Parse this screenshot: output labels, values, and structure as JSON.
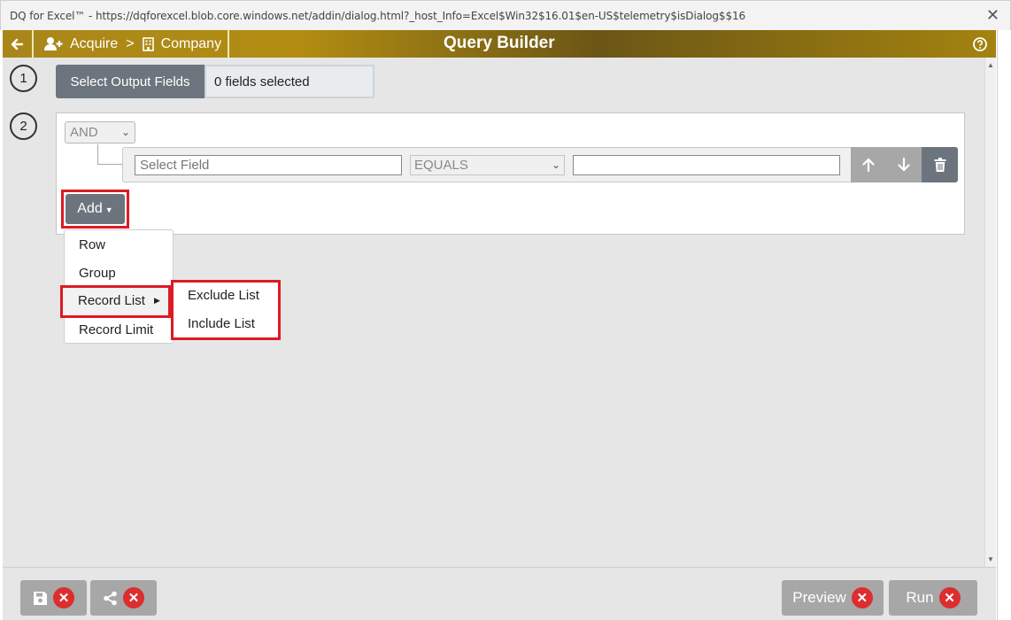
{
  "window": {
    "title": "DQ for Excel™ - https://dqforexcel.blob.core.windows.net/addin/dialog.html?_host_Info=Excel$Win32$16.01$en-US$telemetry$isDialog$$16",
    "close_icon": "close-icon"
  },
  "header": {
    "back_icon": "arrow-left-icon",
    "crumb_acquire": "Acquire",
    "crumb_separator": ">",
    "crumb_company": "Company",
    "title": "Query Builder",
    "help_icon": "question-circle-icon",
    "bar_color": "#A4830F"
  },
  "step1": {
    "number": "1",
    "button_label": "Select Output Fields",
    "fields_selected": "0 fields selected"
  },
  "step2": {
    "number": "2",
    "logic_operator": "AND",
    "row": {
      "field_placeholder": "Select Field",
      "operator": "EQUALS",
      "value": "",
      "up_icon": "arrow-up-icon",
      "down_icon": "arrow-down-icon",
      "delete_icon": "trash-icon"
    },
    "add_label": "Add"
  },
  "add_menu": {
    "items": [
      "Row",
      "Group",
      "Record List",
      "Record Limit"
    ]
  },
  "record_list_submenu": {
    "items": [
      "Exclude List",
      "Include List"
    ]
  },
  "footer": {
    "save_icon": "save-icon",
    "share_icon": "share-icon",
    "preview_label": "Preview",
    "run_label": "Run",
    "disabled_color": "#A7A7A7",
    "badge_color": "#DC2E2E",
    "highlight_color": "#DC1B23"
  }
}
